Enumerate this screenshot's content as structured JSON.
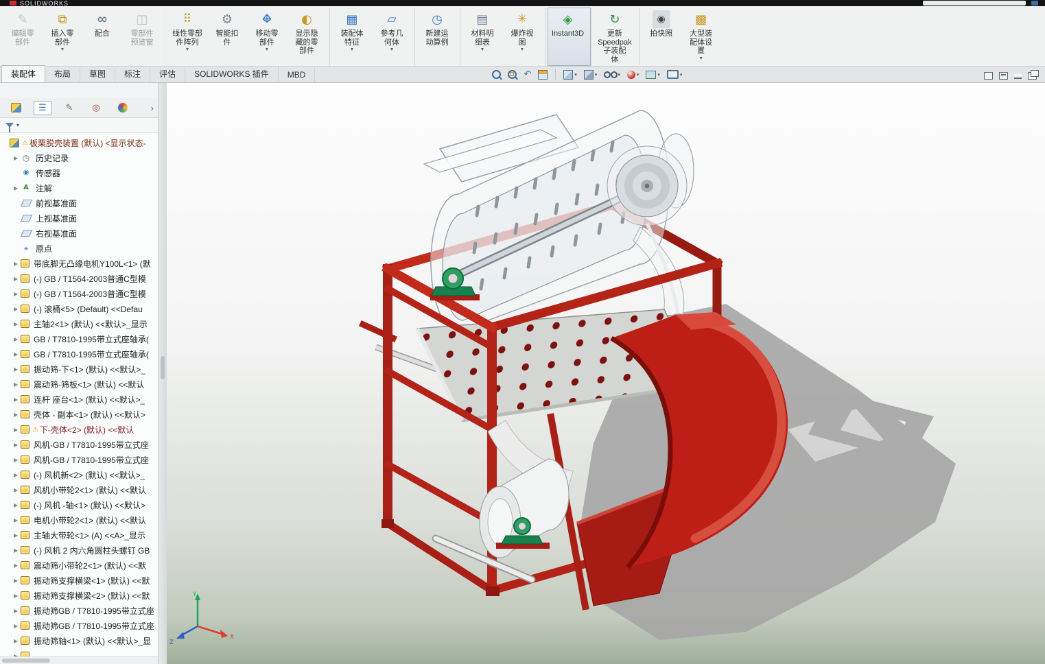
{
  "titlebar": {
    "logo": "SOLIDWORKS"
  },
  "ribbon": {
    "buttons": [
      {
        "kind": "edit-component",
        "label": "编辑零\n部件",
        "disabled": "true"
      },
      {
        "kind": "insert-component",
        "label": "插入零\n部件",
        "arrow": "▼"
      },
      {
        "kind": "mate",
        "label": "配合"
      },
      {
        "kind": "component-preview",
        "label": "零部件\n预览窗",
        "disabled": "true",
        "sep": "true"
      },
      {
        "kind": "linear-pattern",
        "label": "线性零部\n件阵列",
        "arrow": "▼"
      },
      {
        "kind": "smart-fasteners",
        "label": "智能扣\n件"
      },
      {
        "kind": "move-component",
        "label": "移动零\n部件",
        "arrow": "▼"
      },
      {
        "kind": "show-hidden",
        "label": "显示隐\n藏的零\n部件",
        "sep": "true"
      },
      {
        "kind": "assembly-features",
        "label": "装配体\n特征",
        "arrow": "▼"
      },
      {
        "kind": "reference-geometry",
        "label": "参考几\n何体",
        "arrow": "▼",
        "sep": "true"
      },
      {
        "kind": "motion-study",
        "label": "新建运\n动算例",
        "sep": "true"
      },
      {
        "kind": "bom",
        "label": "材料明\n细表",
        "arrow": "▼"
      },
      {
        "kind": "exploded-view",
        "label": "爆炸视\n图",
        "arrow": "▼",
        "sep": "true"
      },
      {
        "kind": "instant3d",
        "label": "Instant3D",
        "active": "true",
        "sep": "true"
      },
      {
        "kind": "speedpak",
        "label": "更新\nSpeedpak\n子装配\n体",
        "sep": "true"
      },
      {
        "kind": "snapshot",
        "label": "拍快照"
      },
      {
        "kind": "large-assembly",
        "label": "大型装\n配体设\n置",
        "arrow": "▼"
      }
    ]
  },
  "tabs": {
    "items": [
      {
        "label": "装配体",
        "active": "true"
      },
      {
        "label": "布局"
      },
      {
        "label": "草图"
      },
      {
        "label": "标注"
      },
      {
        "label": "评估"
      },
      {
        "label": "SOLIDWORKS 插件"
      },
      {
        "label": "MBD"
      }
    ]
  },
  "headsup": {
    "caret": "▾",
    "icons": [
      "zoom-fit",
      "zoom-area",
      "previous-view",
      "section-view",
      "view-orientation",
      "display-style",
      "hide-show-items",
      "edit-appearance",
      "apply-scene",
      "view-settings"
    ]
  },
  "window_icons": [
    "panel-left",
    "panel-right",
    "minimize-ribbon",
    "restore-window"
  ],
  "panel": {
    "tab_icons": [
      "featuremanager-tree",
      "propertymanager",
      "configurationmanager",
      "dimxpertmanager",
      "displaymanager"
    ],
    "chevron": "›",
    "filter_caret": "▾"
  },
  "tree": {
    "items": [
      {
        "icon": "assembly",
        "label": "板栗脱壳装置 (默认) <显示状态-",
        "indent": 0,
        "warn": "⚠",
        "cls": "rootred"
      },
      {
        "icon": "history",
        "caret": "▶",
        "label": "历史记录",
        "indent": 1
      },
      {
        "icon": "sensor",
        "label": "传感器",
        "indent": 1
      },
      {
        "icon": "ann",
        "caret": "▶",
        "label": "注解",
        "indent": 1
      },
      {
        "icon": "plane",
        "label": "前视基准面",
        "indent": 1
      },
      {
        "icon": "plane",
        "label": "上视基准面",
        "indent": 1
      },
      {
        "icon": "plane",
        "label": "右视基准面",
        "indent": 1
      },
      {
        "icon": "origin",
        "label": "原点",
        "indent": 1
      },
      {
        "icon": "part",
        "caret": "▶",
        "label": "带底脚无凸缘电机Y100L<1> (默",
        "indent": 1
      },
      {
        "icon": "part",
        "caret": "▶",
        "label": "(-) GB / T1564-2003普通C型模",
        "indent": 1
      },
      {
        "icon": "part",
        "caret": "▶",
        "label": "(-) GB / T1564-2003普通C型模",
        "indent": 1
      },
      {
        "icon": "part",
        "caret": "▶",
        "label": "(-) 滚桶<5> (Default) <<Defau",
        "indent": 1
      },
      {
        "icon": "part",
        "caret": "▶",
        "label": "主轴2<1> (默认) <<默认>_显示",
        "indent": 1
      },
      {
        "icon": "part",
        "caret": "▶",
        "label": "GB / T7810-1995带立式座轴承(",
        "indent": 1
      },
      {
        "icon": "part",
        "caret": "▶",
        "label": "GB / T7810-1995带立式座轴承(",
        "indent": 1
      },
      {
        "icon": "part",
        "caret": "▶",
        "label": "振动筛-下<1> (默认) <<默认>_",
        "indent": 1
      },
      {
        "icon": "part",
        "caret": "▶",
        "label": "震动筛-筛板<1> (默认) <<默认",
        "indent": 1
      },
      {
        "icon": "part",
        "caret": "▶",
        "label": "连杆 座台<1> (默认) <<默认>_",
        "indent": 1
      },
      {
        "icon": "part",
        "caret": "▶",
        "label": "壳体 - 副本<1> (默认) <<默认>",
        "indent": 1
      },
      {
        "icon": "part",
        "caret": "▶",
        "label": "下-壳体<2> (默认) <<默认",
        "indent": 1,
        "warn": "⚠",
        "cls": "warnred"
      },
      {
        "icon": "part",
        "caret": "▶",
        "label": "风机-GB / T7810-1995带立式座",
        "indent": 1
      },
      {
        "icon": "part",
        "caret": "▶",
        "label": "风机-GB / T7810-1995带立式座",
        "indent": 1
      },
      {
        "icon": "part",
        "caret": "▶",
        "label": "(-) 风机新<2> (默认) <<默认>_",
        "indent": 1
      },
      {
        "icon": "part",
        "caret": "▶",
        "label": "风机小带轮2<1> (默认) <<默认",
        "indent": 1
      },
      {
        "icon": "part",
        "caret": "▶",
        "label": "(-) 风机 -轴<1> (默认) <<默认>",
        "indent": 1
      },
      {
        "icon": "part",
        "caret": "▶",
        "label": "电机小带轮2<1> (默认) <<默认",
        "indent": 1
      },
      {
        "icon": "part",
        "caret": "▶",
        "label": "主轴大带轮<1> (A) <<A>_显示",
        "indent": 1
      },
      {
        "icon": "part",
        "caret": "▶",
        "label": "(-) 风机 2 内六角圆柱头螺钉 GB",
        "indent": 1
      },
      {
        "icon": "part",
        "caret": "▶",
        "label": "震动筛小带轮2<1> (默认) <<默",
        "indent": 1
      },
      {
        "icon": "part",
        "caret": "▶",
        "label": "振动筛支撑横梁<1> (默认) <<默",
        "indent": 1
      },
      {
        "icon": "part",
        "caret": "▶",
        "label": "振动筛支撑横梁<2> (默认) <<默",
        "indent": 1
      },
      {
        "icon": "part",
        "caret": "▶",
        "label": "振动筛GB / T7810-1995带立式座",
        "indent": 1
      },
      {
        "icon": "part",
        "caret": "▶",
        "label": "振动筛GB / T7810-1995带立式座",
        "indent": 1
      },
      {
        "icon": "part",
        "caret": "▶",
        "label": "振动筛轴<1> (默认) <<默认>_显",
        "indent": 1
      },
      {
        "icon": "part",
        "caret": "▶",
        "label": "",
        "indent": 1
      }
    ]
  },
  "viewport": {
    "triad": {
      "x": "X",
      "y": "Y",
      "z": "Z"
    },
    "colors": {
      "frame_red": "#b42318",
      "chute_red": "#bd1f17",
      "bearing_green": "#2aa263",
      "shadow_gray": "#a6a6a6",
      "hole_red": "#7c1210"
    }
  }
}
